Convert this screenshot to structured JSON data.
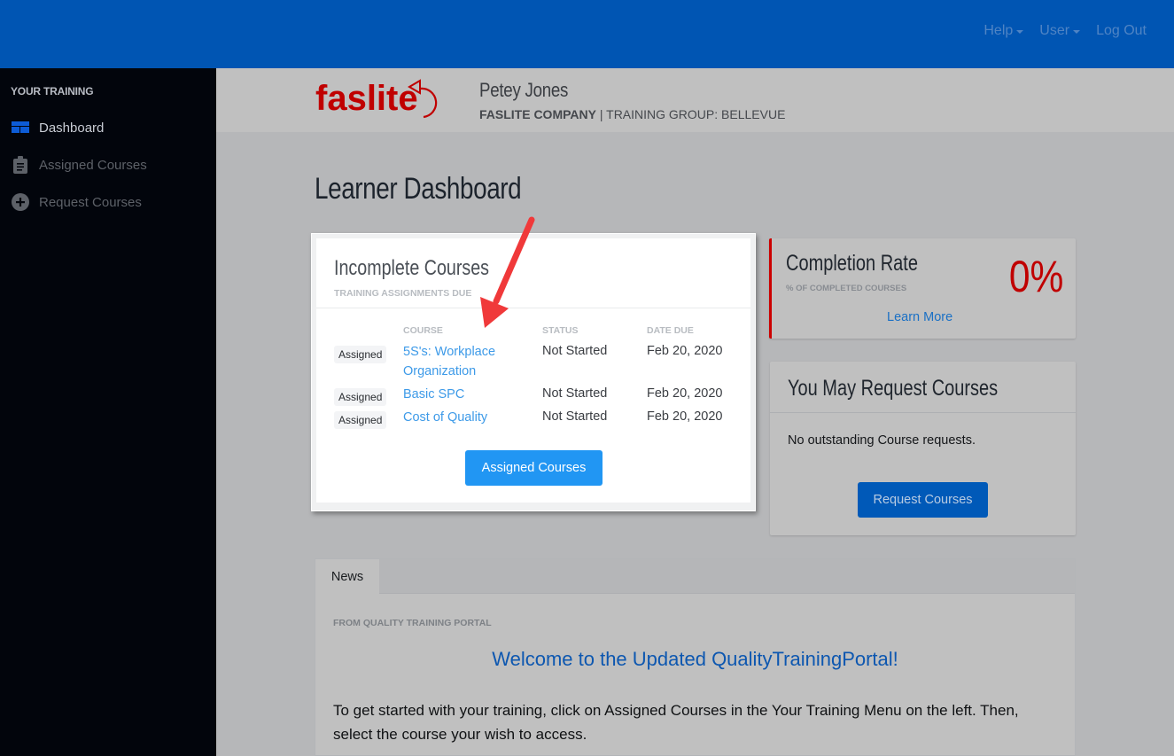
{
  "topnav": {
    "help": "Help",
    "user": "User",
    "logout": "Log Out"
  },
  "sidebar": {
    "title": "YOUR TRAINING",
    "items": [
      {
        "label": "Dashboard",
        "icon": "dashboard-icon",
        "active": true
      },
      {
        "label": "Assigned Courses",
        "icon": "clipboard-icon",
        "active": false
      },
      {
        "label": "Request Courses",
        "icon": "plus-circle-icon",
        "active": false
      }
    ]
  },
  "header": {
    "logo_text": "faslite",
    "user_name": "Petey Jones",
    "company": "FASLITE COMPANY",
    "separator": " | ",
    "group": "TRAINING GROUP: BELLEVUE"
  },
  "page": {
    "title": "Learner Dashboard"
  },
  "incomplete": {
    "title": "Incomplete Courses",
    "subtitle": "TRAINING ASSIGNMENTS DUE",
    "columns": {
      "course": "COURSE",
      "status": "STATUS",
      "due": "DATE DUE"
    },
    "rows": [
      {
        "badge": "Assigned",
        "course": "5S's: Workplace Organization",
        "status": "Not Started",
        "due": "Feb 20, 2020"
      },
      {
        "badge": "Assigned",
        "course": "Basic SPC",
        "status": "Not Started",
        "due": "Feb 20, 2020"
      },
      {
        "badge": "Assigned",
        "course": "Cost of Quality",
        "status": "Not Started",
        "due": "Feb 20, 2020"
      }
    ],
    "button": "Assigned Courses"
  },
  "completion": {
    "title": "Completion Rate",
    "subtitle": "% OF COMPLETED COURSES",
    "value": "0%",
    "link": "Learn More",
    "accent": "#cc0000"
  },
  "request": {
    "title": "You May Request Courses",
    "text": "No outstanding Course requests.",
    "button": "Request Courses"
  },
  "news": {
    "tab": "News",
    "from": "FROM QUALITY TRAINING PORTAL",
    "heading": "Welcome to the Updated QualityTrainingPortal!",
    "body": "To get started with your training, click on Assigned Courses in the Your Training Menu on the left. Then, select the course your wish to access."
  },
  "colors": {
    "topbar": "#0055b3",
    "sidebar": "#02050c",
    "link": "#3d9ae8",
    "primary_button": "#2196f3",
    "brand_red": "#c00000"
  }
}
